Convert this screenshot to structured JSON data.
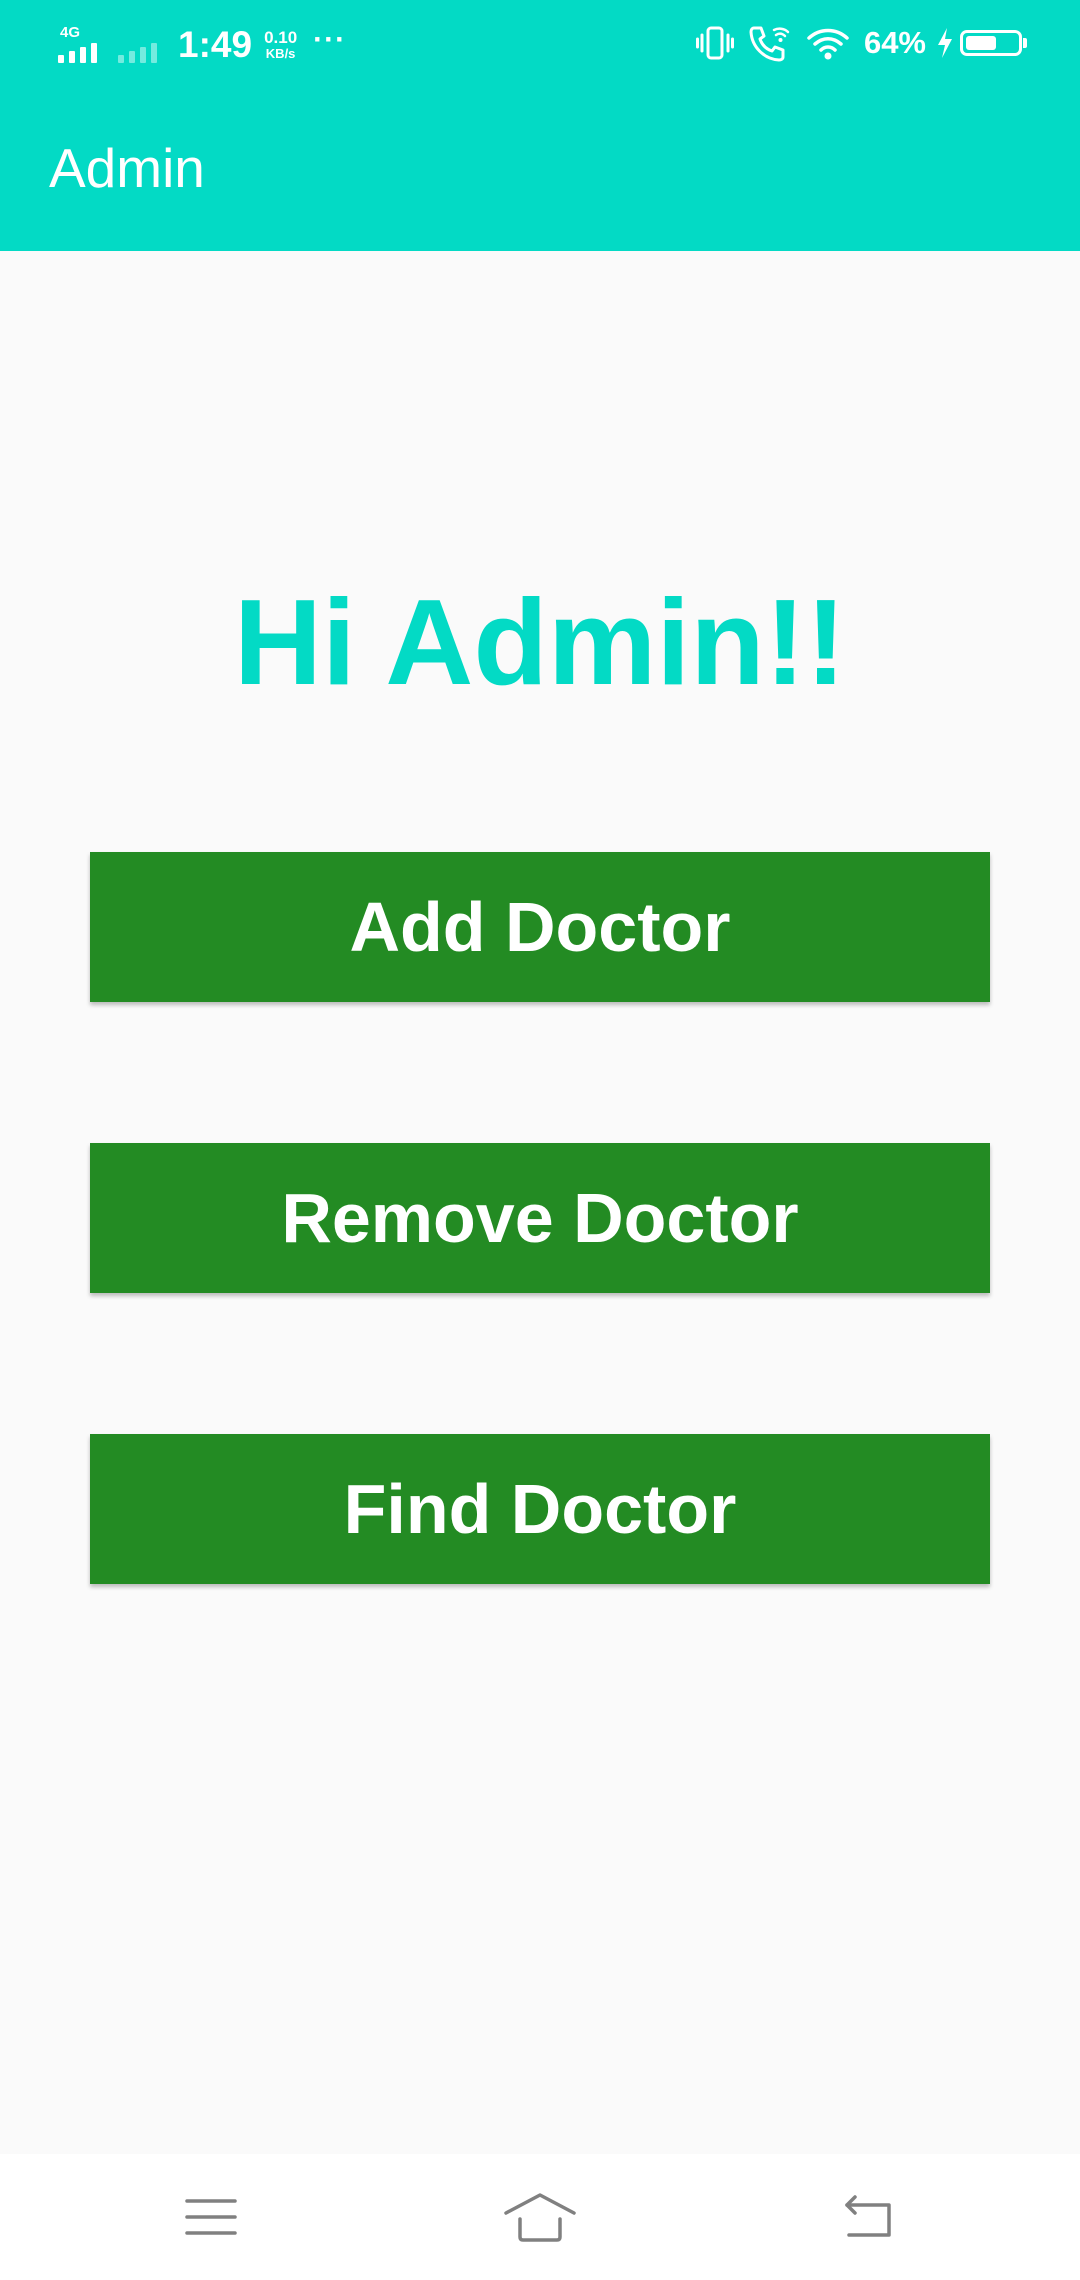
{
  "colors": {
    "accent": "#03dac5",
    "button": "#238b23",
    "background": "#fafafa",
    "nav_icon": "#808080"
  },
  "status_bar": {
    "network_type": "4G",
    "time": "1:49",
    "speed_value": "0.10",
    "speed_unit": "KB/s",
    "more": "···",
    "battery_percent": "64%",
    "battery_level": 0.64,
    "icons": [
      "vibrate-icon",
      "wifi-calling-icon",
      "wifi-icon",
      "charging-icon",
      "battery-icon"
    ]
  },
  "app_bar": {
    "title": "Admin"
  },
  "main": {
    "greeting": "Hi Admin!!",
    "buttons": {
      "add": "Add Doctor",
      "remove": "Remove Doctor",
      "find": "Find Doctor"
    }
  },
  "nav_bar": {
    "icons": [
      "menu-icon",
      "home-icon",
      "back-icon"
    ]
  }
}
